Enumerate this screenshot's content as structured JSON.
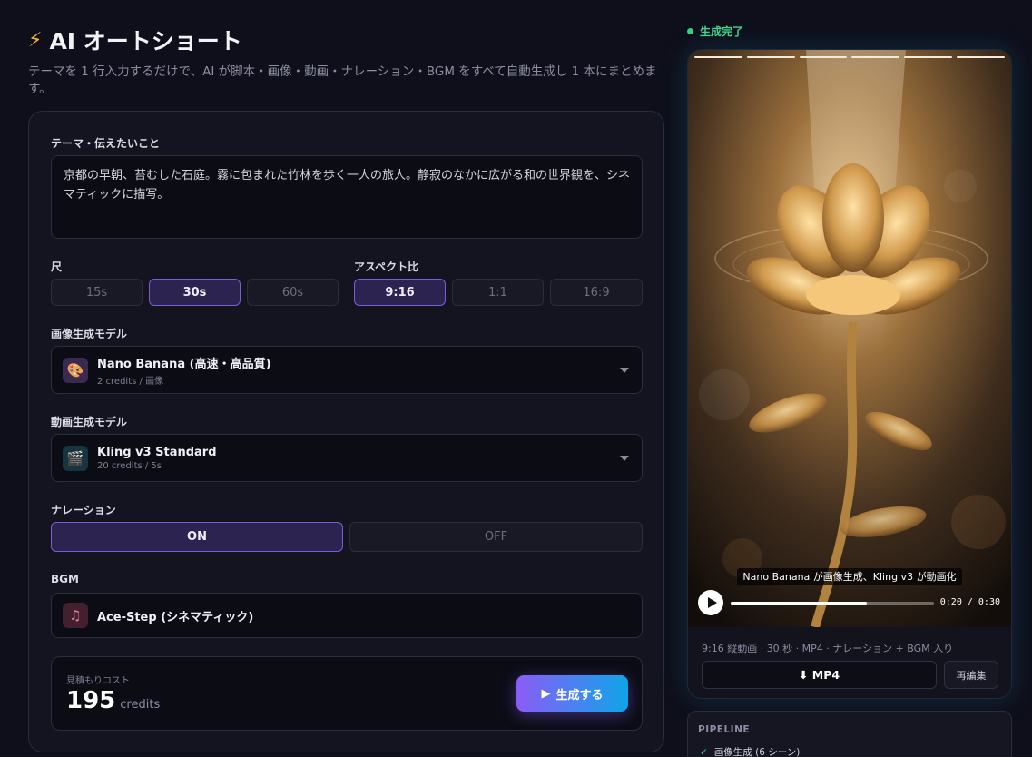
{
  "header": {
    "icon": "lightning-icon",
    "title": "AI オートショート",
    "subtitle": "テーマを 1 行入力するだけで、AI が脚本・画像・動画・ナレーション・BGM をすべて自動生成し 1 本にまとめます。"
  },
  "form": {
    "theme_label": "テーマ・伝えたいこと",
    "theme_value": "京都の早朝、苔むした石庭。霧に包まれた竹林を歩く一人の旅人。静寂のなかに広がる和の世界観を、シネマティックに描写。",
    "duration_label": "尺",
    "durations": [
      "15s",
      "30s",
      "60s"
    ],
    "duration_selected": "30s",
    "aspect_label": "アスペクト比",
    "aspects": [
      "9:16",
      "1:1",
      "16:9"
    ],
    "aspect_selected": "9:16",
    "image_model_label": "画像生成モデル",
    "image_model": {
      "icon": "palette-icon",
      "name": "Nano Banana (高速・高品質)",
      "cost": "2 credits / 画像"
    },
    "video_model_label": "動画生成モデル",
    "video_model": {
      "icon": "clapper-icon",
      "name": "Kling v3 Standard",
      "cost": "20 credits / 5s"
    },
    "narration_label": "ナレーション",
    "narration_on": "ON",
    "narration_off": "OFF",
    "bgm_label": "BGM",
    "bgm": {
      "icon": "music-note-icon",
      "name": "Ace-Step (シネマティック)"
    },
    "cost_label": "見積もりコスト",
    "cost_value": "195",
    "cost_unit": "credits",
    "generate_label": "生成する"
  },
  "preview": {
    "status": "生成完了",
    "status_color": "#34d17f",
    "caption": "Nano Banana が画像生成、Kling v3 が動画化",
    "time": "0:20 / 0:30",
    "progress": 0.67,
    "meta": "9:16 縦動画 · 30 秒 · MP4 · ナレーション + BGM 入り",
    "download_label": "⬇ MP4",
    "reedit_label": "再編集"
  },
  "pipeline": {
    "heading": "PIPELINE",
    "items": [
      "画像生成 (6 シーン)"
    ]
  }
}
